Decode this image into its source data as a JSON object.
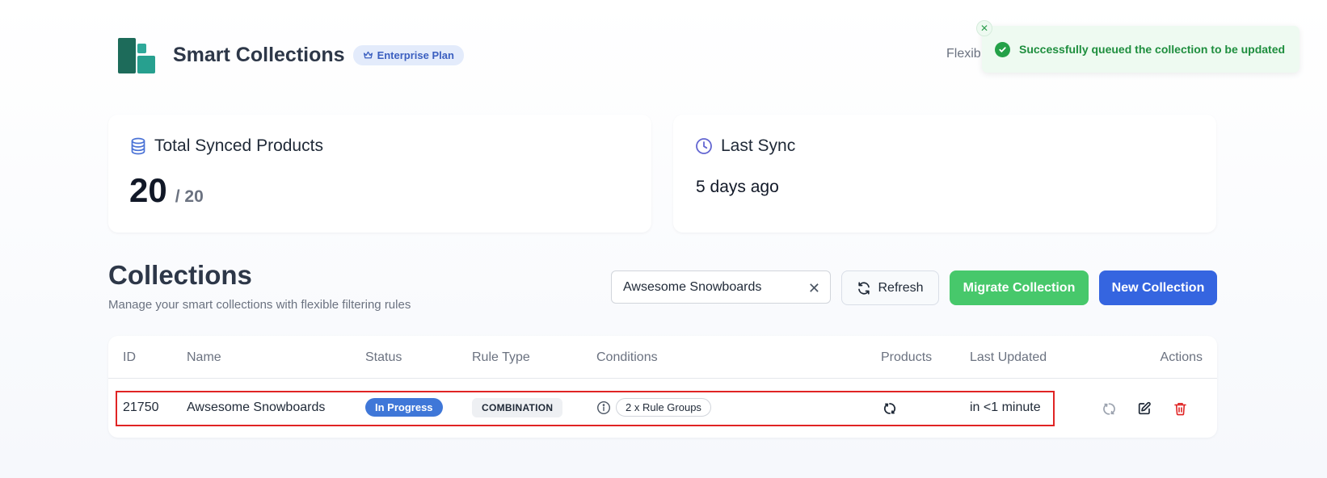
{
  "header": {
    "title": "Smart Collections",
    "plan_badge": "Enterprise Plan",
    "partial_text": "Flexib"
  },
  "toast": {
    "message": "Successfully queued the collection to be updated",
    "close_icon": "close-icon",
    "status_icon": "check-circle-icon"
  },
  "stats": {
    "synced": {
      "label": "Total Synced Products",
      "value": "20",
      "limit": "/ 20",
      "icon": "database-icon"
    },
    "last_sync": {
      "label": "Last Sync",
      "value": "5 days ago",
      "icon": "clock-icon"
    }
  },
  "collections": {
    "title": "Collections",
    "subtitle": "Manage your smart collections with flexible filtering rules",
    "search_value": "Awsesome Snowboards",
    "refresh_label": "Refresh",
    "migrate_label": "Migrate Collection",
    "new_label": "New Collection"
  },
  "table": {
    "columns": [
      "ID",
      "Name",
      "Status",
      "Rule Type",
      "Conditions",
      "Products",
      "Last Updated",
      "Actions"
    ],
    "rows": [
      {
        "id": "21750",
        "name": "Awsesome Snowboards",
        "status": "In Progress",
        "rule_type": "COMBINATION",
        "conditions": "2 x Rule Groups",
        "products_icon": "sync-icon",
        "last_updated": "in <1 minute"
      }
    ]
  },
  "colors": {
    "status_in_progress": "#3f77d8",
    "migrate_button": "#47c86b",
    "new_button": "#3565e0",
    "toast_success": "#1e8e3e",
    "highlight_outline": "#e02424"
  }
}
